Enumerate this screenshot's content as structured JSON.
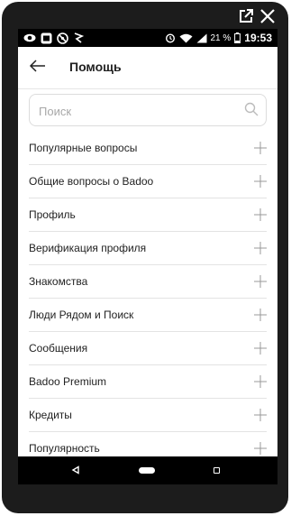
{
  "status_bar": {
    "icons": [
      "eye-icon",
      "screen-icon",
      "no-sign-icon",
      "flag-icon"
    ],
    "right_icons": [
      "alarm-icon",
      "wifi-icon",
      "signal-icon"
    ],
    "battery": "21 %",
    "time": "19:53"
  },
  "window_controls": {
    "icons": [
      "popout-icon",
      "close-icon"
    ]
  },
  "header": {
    "back_icon": "arrow-left-icon",
    "title": "Помощь"
  },
  "search": {
    "placeholder": "Поиск",
    "value": "",
    "icon": "search-icon"
  },
  "help_items": [
    {
      "label": "Популярные вопросы"
    },
    {
      "label": "Общие вопросы о Badoo"
    },
    {
      "label": "Профиль"
    },
    {
      "label": "Верификация профиля"
    },
    {
      "label": "Знакомства"
    },
    {
      "label": "Люди Рядом и Поиск"
    },
    {
      "label": "Сообщения"
    },
    {
      "label": "Badoo Premium"
    },
    {
      "label": "Кредиты"
    },
    {
      "label": "Популярность"
    }
  ],
  "nav_bar": {
    "buttons": [
      "back-triangle-icon",
      "home-pill-icon",
      "recents-square-icon"
    ]
  },
  "colors": {
    "frame": "#1c1c1c",
    "status_bar": "#000000",
    "divider": "#e3e3e3",
    "text": "#222222",
    "placeholder": "#a8a8a8"
  }
}
